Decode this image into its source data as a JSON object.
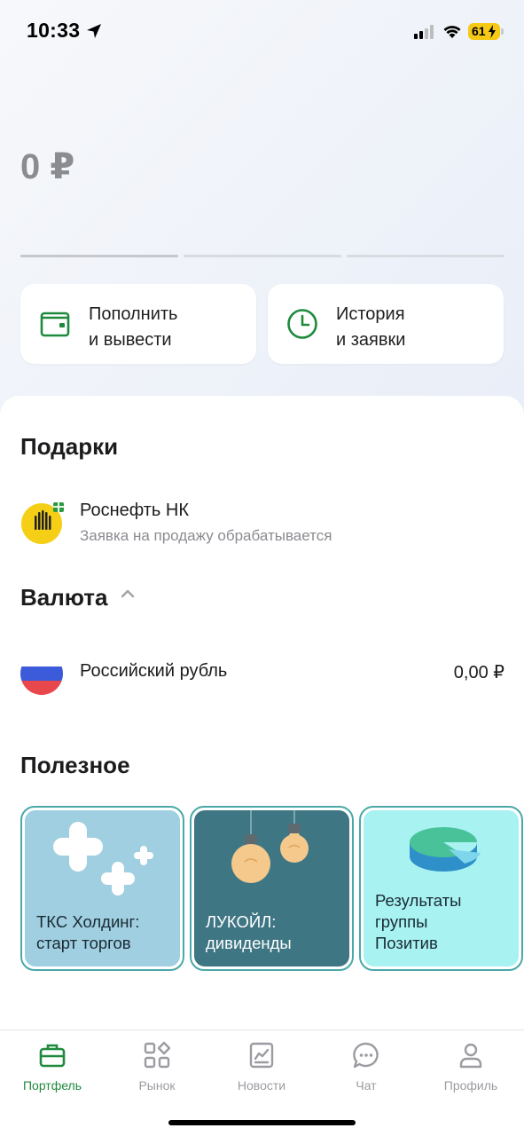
{
  "status_bar": {
    "time": "10:33",
    "battery": "61"
  },
  "portfolio": {
    "balance": "0 ₽"
  },
  "actions": [
    {
      "label_line1": "Пополнить",
      "label_line2": "и вывести",
      "icon": "wallet-icon"
    },
    {
      "label_line1": "История",
      "label_line2": "и заявки",
      "icon": "clock-icon"
    }
  ],
  "gifts": {
    "title": "Подарки",
    "item": {
      "name": "Роснефть НК",
      "status": "Заявка на продажу обрабатывается",
      "icon": "rosneft-logo"
    }
  },
  "currency": {
    "title": "Валюта",
    "item": {
      "name": "Российский рубль",
      "amount": "0,00 ₽",
      "icon": "russia-flag"
    }
  },
  "useful": {
    "title": "Полезное",
    "stories": [
      {
        "line1": "ТКС Холдинг:",
        "line2": "старт торгов",
        "line3": ""
      },
      {
        "line1": "ЛУКОЙЛ:",
        "line2": "дивиденды",
        "line3": ""
      },
      {
        "line1": "Результаты",
        "line2": "группы",
        "line3": "Позитив"
      }
    ]
  },
  "tabbar": [
    {
      "label": "Портфель",
      "icon": "briefcase-icon",
      "active": true
    },
    {
      "label": "Рынок",
      "icon": "market-icon",
      "active": false
    },
    {
      "label": "Новости",
      "icon": "news-icon",
      "active": false
    },
    {
      "label": "Чат",
      "icon": "chat-icon",
      "active": false
    },
    {
      "label": "Профиль",
      "icon": "profile-icon",
      "active": false
    }
  ],
  "colors": {
    "accent": "#1f8a3d",
    "muted": "#8a8c91"
  }
}
